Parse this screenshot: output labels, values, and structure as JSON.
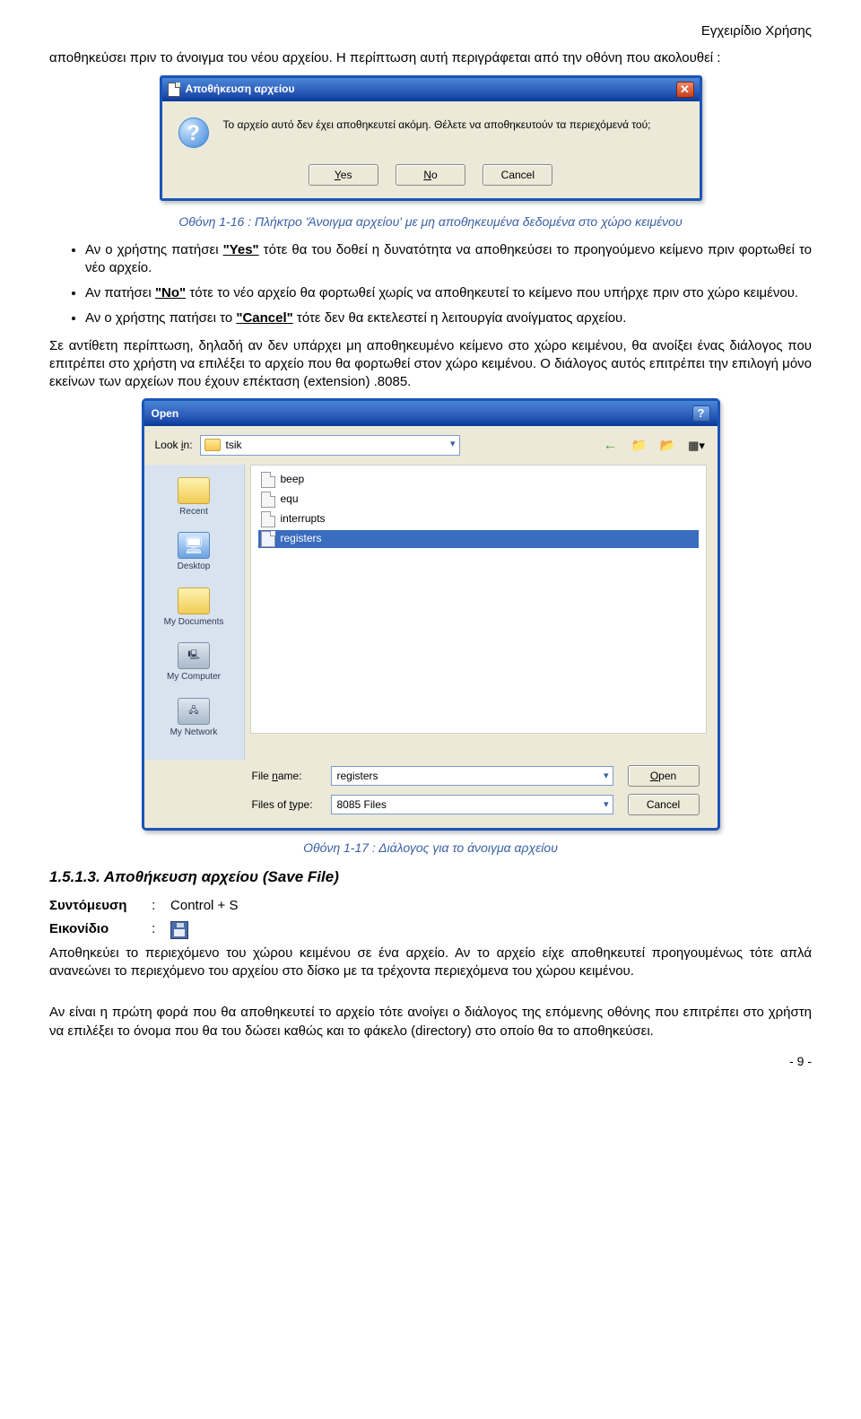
{
  "header_right": "Εγχειρίδιο Χρήσης",
  "para_top": "αποθηκεύσει πριν το άνοιγμα του νέου αρχείου. Η περίπτωση αυτή περιγράφεται από την οθόνη που ακολουθεί :",
  "save_dialog": {
    "title": "Αποθήκευση αρχείου",
    "message": "Το αρχείο αυτό δεν έχει αποθηκευτεί ακόμη. Θέλετε να αποθηκευτούν τα περιεχόμενά τού;",
    "yes": "Yes",
    "no": "No",
    "cancel": "Cancel"
  },
  "caption1": "Οθόνη 1-16 : Πλήκτρο 'Άνοιγμα αρχείου' με μη αποθηκευμένα δεδομένα στο χώρο κειμένου",
  "bullets": [
    {
      "pre": "Αν ο χρήστης πατήσει ",
      "key": "\"Yes\"",
      "post": " τότε θα του δοθεί η δυνατότητα να αποθηκεύσει το προηγούμενο κείμενο πριν φορτωθεί το νέο αρχείο."
    },
    {
      "pre": "Αν πατήσει ",
      "key": "\"No\"",
      "post": " τότε το νέο αρχείο θα φορτωθεί χωρίς να αποθηκευτεί το κείμενο που υπήρχε πριν στο χώρο κειμένου."
    },
    {
      "pre": "Αν ο χρήστης πατήσει το ",
      "key": "\"Cancel\"",
      "post": " τότε δεν θα εκτελεστεί η λειτουργία ανοίγματος αρχείου."
    }
  ],
  "para_after_bullets": "Σε αντίθετη περίπτωση, δηλαδή αν δεν υπάρχει μη αποθηκευμένο κείμενο στο χώρο κειμένου, θα ανοίξει ένας διάλογος που επιτρέπει στο χρήστη να επιλέξει το αρχείο που θα φορτωθεί στον χώρο κειμένου. Ο διάλογος αυτός επιτρέπει την επιλογή μόνο εκείνων των αρχείων που έχουν επέκταση (extension) .8085.",
  "open_dialog": {
    "title": "Open",
    "look_in_label": "Look in:",
    "look_in_value": "tsik",
    "places": {
      "recent": "Recent",
      "desktop": "Desktop",
      "documents": "My Documents",
      "computer": "My Computer",
      "network": "My Network"
    },
    "files": [
      "beep",
      "equ",
      "interrupts",
      "registers"
    ],
    "selected_file": "registers",
    "file_name_label": "File name:",
    "file_name_value": "registers",
    "file_type_label": "Files of type:",
    "file_type_value": "8085 Files",
    "open_btn": "Open",
    "cancel_btn": "Cancel"
  },
  "caption2": "Οθόνη 1-17 : Διάλογος για το άνοιγμα αρχείου",
  "sec_heading": "1.5.1.3. Αποθήκευση αρχείου (Save File)",
  "shortcut_label": "Συντόμευση",
  "shortcut_value": "Control + S",
  "icon_label": "Εικονίδιο",
  "para_save1": "Αποθηκεύει το περιεχόμενο του χώρου κειμένου σε ένα αρχείο. Αν το αρχείο είχε αποθηκευτεί προηγουμένως τότε απλά ανανεώνει το περιεχόμενο του αρχείου στο δίσκο με τα τρέχοντα περιεχόμενα του χώρου κειμένου.",
  "para_save2": "Αν είναι η πρώτη φορά που θα αποθηκευτεί το αρχείο τότε ανοίγει ο διάλογος της επόμενης οθόνης που επιτρέπει στο χρήστη να επιλέξει το όνομα που θα του δώσει καθώς και το φάκελο (directory) στο οποίο θα το αποθηκεύσει.",
  "page_num": "- 9 -"
}
